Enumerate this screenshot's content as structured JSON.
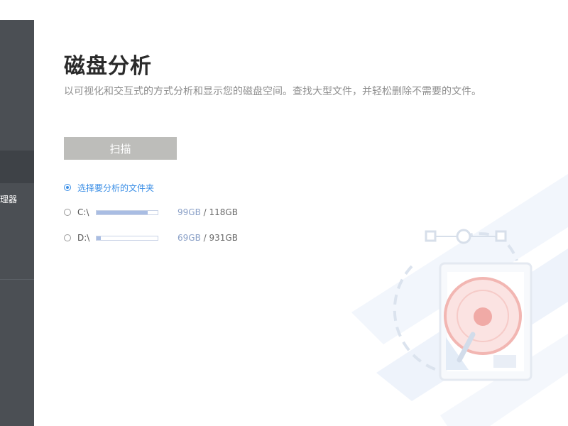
{
  "sidebar": {
    "visible_item_label": "理器"
  },
  "page": {
    "title": "磁盘分析",
    "subtitle": "以可视化和交互式的方式分析和显示您的磁盘空间。查找大型文件，并轻松删除不需要的文件。"
  },
  "scan_button_label": "扫描",
  "folder_option": {
    "label": "选择要分析的文件夹",
    "selected": true
  },
  "drives": [
    {
      "label": "C:\\",
      "used": "99GB",
      "separator": " / ",
      "total": "118GB",
      "usage_fraction": 0.84
    },
    {
      "label": "D:\\",
      "used": "69GB",
      "separator": " / ",
      "total": "931GB",
      "usage_fraction": 0.074
    }
  ],
  "colors": {
    "sidebar_bg": "#4b4f54",
    "sidebar_active": "#3e4247",
    "accent_blue": "#3a8ee6",
    "button_gray": "#bdbdba",
    "bar_fill": "#a9bde3",
    "illustration_red": "#f2b6b2"
  },
  "icons": {
    "illustration": "hard-disk-illustration",
    "radio": "radio-button"
  }
}
